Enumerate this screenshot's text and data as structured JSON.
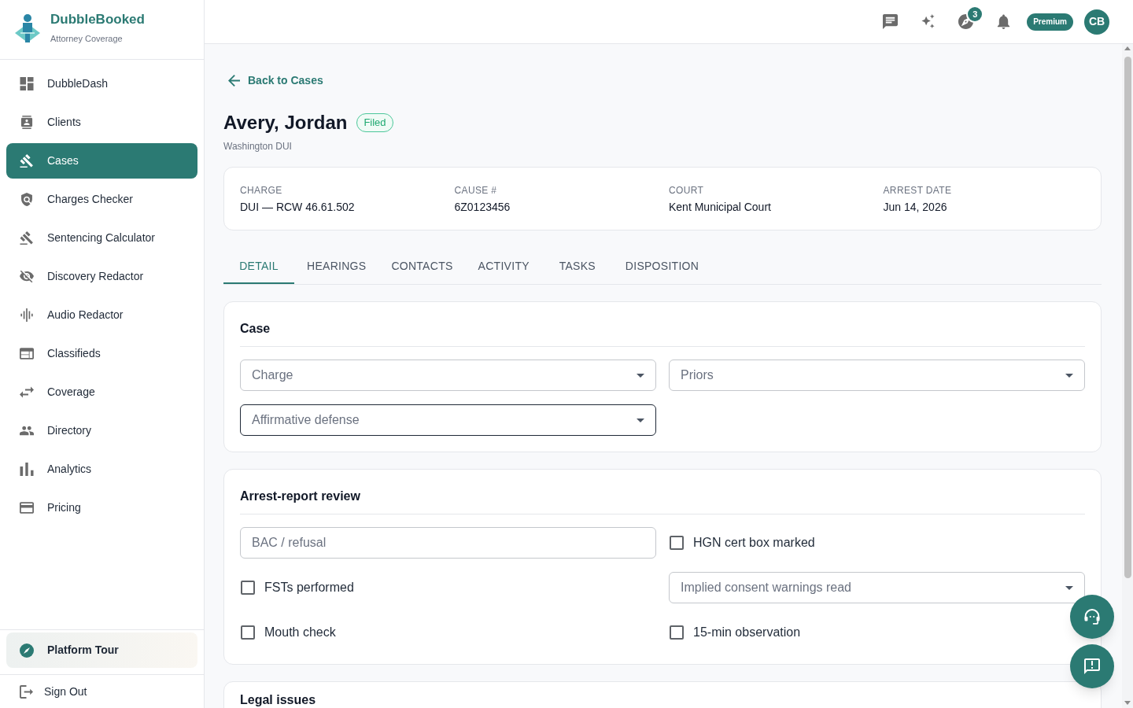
{
  "sidebar": {
    "brand": {
      "name": "DubbleBooked",
      "tagline": "Attorney Coverage"
    },
    "nav": [
      {
        "label": "DubbleDash",
        "selected": false
      },
      {
        "label": "Clients",
        "selected": false
      },
      {
        "label": "Cases",
        "selected": true
      },
      {
        "label": "Charges Checker",
        "selected": false
      },
      {
        "label": "Sentencing Calculator",
        "selected": false
      },
      {
        "label": "Discovery Redactor",
        "selected": false
      },
      {
        "label": "Audio Redactor",
        "selected": false
      },
      {
        "label": "Classifieds",
        "selected": false
      },
      {
        "label": "Coverage",
        "selected": false
      },
      {
        "label": "Directory",
        "selected": false
      },
      {
        "label": "Analytics",
        "selected": false
      },
      {
        "label": "Pricing",
        "selected": false
      }
    ],
    "tour": {
      "label": "Platform Tour"
    },
    "sign_out": {
      "label": "Sign Out"
    }
  },
  "top_bar": {
    "tour_badge": "3",
    "plan": "Premium",
    "avatar": "CB"
  },
  "back_link": "Back to Cases",
  "header": {
    "title": "Avery, Jordan",
    "status": "Filed",
    "subtitle": "Washington DUI"
  },
  "summary": [
    {
      "label": "CHARGE",
      "value": "DUI — RCW 46.61.502"
    },
    {
      "label": "CAUSE #",
      "value": "6Z0123456"
    },
    {
      "label": "COURT",
      "value": "Kent Municipal Court"
    },
    {
      "label": "ARREST DATE",
      "value": "Jun 14, 2026"
    }
  ],
  "tabs": [
    {
      "label": "DETAIL",
      "selected": true
    },
    {
      "label": "HEARINGS",
      "selected": false
    },
    {
      "label": "CONTACTS",
      "selected": false
    },
    {
      "label": "ACTIVITY",
      "selected": false
    },
    {
      "label": "TASKS",
      "selected": false
    },
    {
      "label": "DISPOSITION",
      "selected": false
    }
  ],
  "sections": [
    {
      "title": "Case",
      "fields": [
        {
          "kind": "select",
          "placeholder": "Charge",
          "focused": false
        },
        {
          "kind": "select",
          "placeholder": "Priors",
          "focused": false
        },
        {
          "kind": "select",
          "placeholder": "Affirmative defense",
          "focused": true
        }
      ]
    },
    {
      "title": "Arrest-report review",
      "fields": [
        {
          "kind": "input",
          "placeholder": "BAC / refusal",
          "focused": false
        },
        {
          "kind": "checkbox",
          "label": "HGN cert box marked",
          "checked": false,
          "focused": false
        },
        {
          "kind": "checkbox",
          "label": "FSTs performed",
          "checked": false,
          "focused": false
        },
        {
          "kind": "select",
          "placeholder": "Implied consent warnings read",
          "focused": false
        },
        {
          "kind": "checkbox",
          "label": "Mouth check",
          "checked": false,
          "focused": false
        },
        {
          "kind": "checkbox",
          "label": "15-min observation",
          "checked": false,
          "focused": false
        }
      ]
    },
    {
      "title": "Legal issues"
    }
  ]
}
